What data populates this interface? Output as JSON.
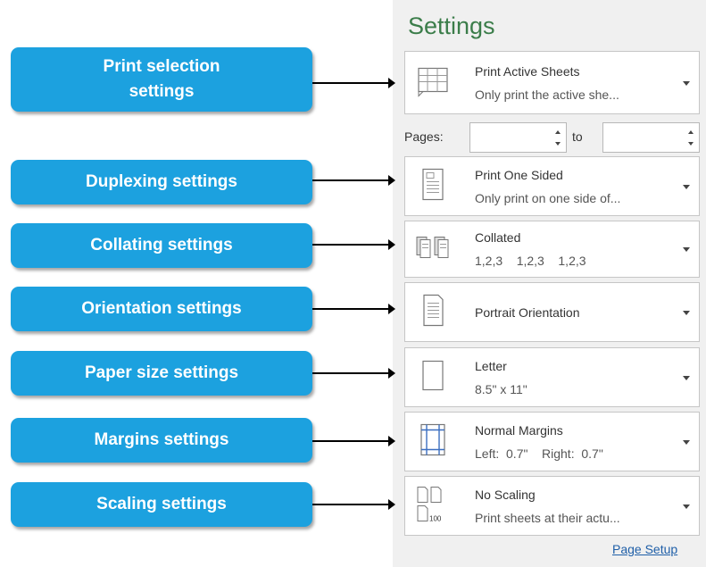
{
  "settings_title": "Settings",
  "pages": {
    "label": "Pages:",
    "from_value": "",
    "to_label": "to",
    "to_value": ""
  },
  "dropdowns": [
    {
      "name": "print-what",
      "icon": "sheets-grid-icon",
      "line1": "Print Active Sheets",
      "line2": "Only print the active she..."
    },
    {
      "name": "duplex",
      "icon": "one-sided-page-icon",
      "line1": "Print One Sided",
      "line2": "Only print on one side of..."
    },
    {
      "name": "collate",
      "icon": "collated-pages-icon",
      "line1": "Collated",
      "line2": "1,2,3    1,2,3    1,2,3"
    },
    {
      "name": "orientation",
      "icon": "portrait-page-icon",
      "line1": "Portrait Orientation",
      "line2": ""
    },
    {
      "name": "paper-size",
      "icon": "blank-page-icon",
      "line1": "Letter",
      "line2": "8.5\" x 11\""
    },
    {
      "name": "margins",
      "icon": "margins-page-icon",
      "line1": "Normal Margins",
      "line2": "Left:  0.7\"    Right:  0.7\""
    },
    {
      "name": "scaling",
      "icon": "scaling-pages-icon",
      "line1": "No Scaling",
      "line2": "Print sheets at their actu..."
    }
  ],
  "page_setup_link": "Page Setup",
  "callouts": [
    "Print selection settings",
    "Duplexing settings",
    "Collating settings",
    "Orientation settings",
    "Paper size settings",
    "Margins settings",
    "Scaling settings"
  ],
  "colors": {
    "callout": "#1ca1df",
    "title": "#3b7d4a",
    "link": "#1f5fa8",
    "panel": "#f0f0f0"
  }
}
